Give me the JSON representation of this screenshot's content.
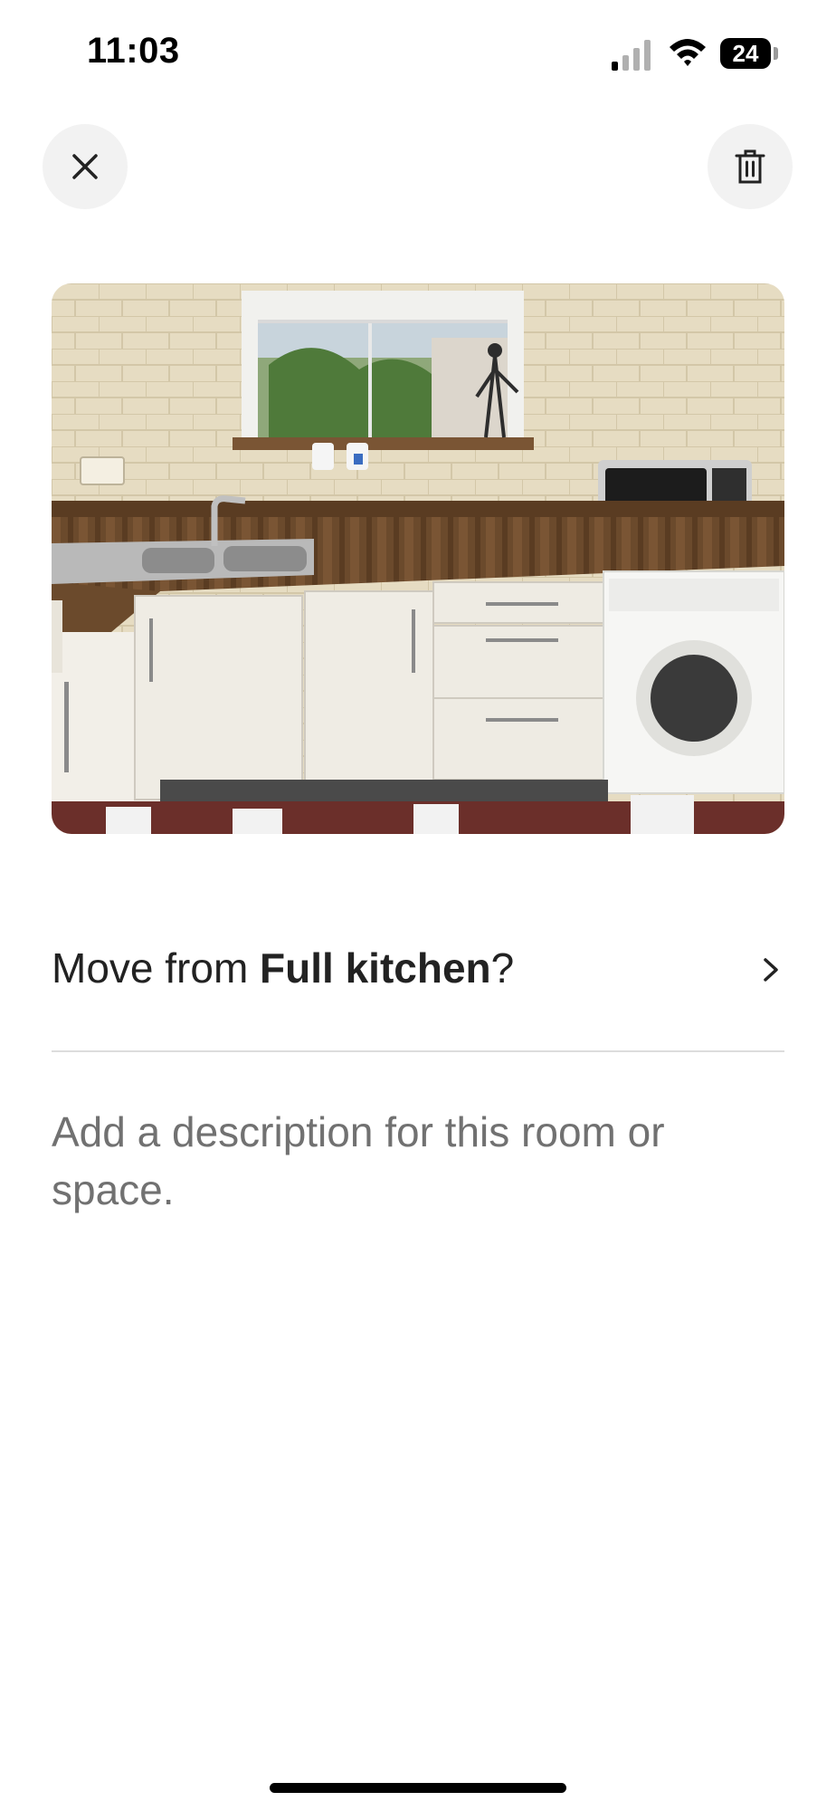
{
  "status_bar": {
    "time": "11:03",
    "battery": "24",
    "icons": [
      "signal-icon",
      "wifi-icon",
      "battery-icon"
    ]
  },
  "header": {
    "close_icon": "close-icon",
    "delete_icon": "trash-icon"
  },
  "photo": {
    "subject": "kitchen"
  },
  "move_row": {
    "prefix": "Move from ",
    "room": "Full kitchen",
    "suffix": "?",
    "icon": "chevron-right-icon"
  },
  "description": {
    "placeholder": "Add a description for this room or space."
  },
  "colors": {
    "text_primary": "#222222",
    "text_secondary": "#717171",
    "button_bg": "#f2f2f2",
    "divider": "#dddddd"
  }
}
